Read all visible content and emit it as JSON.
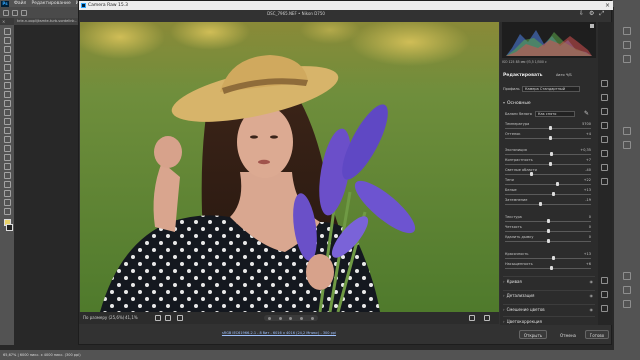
{
  "ps": {
    "logo": "Ps",
    "menu": [
      "Файл",
      "Редактирование",
      "Изображ"
    ],
    "tab": "krie-n-ooplijksmte-turb-vordelink..",
    "status": "65,67% | 6000 пикс. x 4000 пикс. (300 ppi)"
  },
  "cr": {
    "title": "Camera Raw 15.3",
    "filename": "DSC_7965.NEF  •  Nikon D750",
    "zoom_label": "По размеру (25,6%)",
    "zoom_value": "41,1%",
    "workflow": "sRGB IEC61966-2.1 - 8 бит - 6016 x 4016 (24,2 Мпикс) - 300 ppi",
    "histogram_info": "ISO 125   85 мм   f/3,5   1/500 с",
    "edit_title": "Редактировать",
    "auto": "Авто   Ч/Б",
    "profile_label": "Профиль",
    "profile_value": "Камера Стандартный",
    "basic": "Основные",
    "wb_label": "Баланс белого",
    "wb_value": "Как снято",
    "sliders": [
      {
        "label": "Температура",
        "value": "5700",
        "pos": 0.52
      },
      {
        "label": "Оттенок",
        "value": "+4",
        "pos": 0.52
      },
      {
        "label": "Экспозиция",
        "value": "+0,35",
        "pos": 0.54
      },
      {
        "label": "Контрастность",
        "value": "+7",
        "pos": 0.52
      },
      {
        "label": "Светлые области",
        "value": "-40",
        "pos": 0.3
      },
      {
        "label": "Тени",
        "value": "+22",
        "pos": 0.61
      },
      {
        "label": "Белые",
        "value": "+13",
        "pos": 0.56
      },
      {
        "label": "Затемнение",
        "value": "-19",
        "pos": 0.4
      },
      {
        "label": "Текстура",
        "value": "0",
        "pos": 0.5
      },
      {
        "label": "Четкость",
        "value": "0",
        "pos": 0.5
      },
      {
        "label": "Удалить дымку",
        "value": "0",
        "pos": 0.5
      },
      {
        "label": "Красочность",
        "value": "+13",
        "pos": 0.56
      },
      {
        "label": "Насыщенность",
        "value": "+6",
        "pos": 0.53
      }
    ],
    "sections": [
      "Кривая",
      "Детализация",
      "Смешение цветов",
      "Цветокоррекция"
    ],
    "buttons": {
      "open": "Открыть",
      "cancel": "Отмена",
      "done": "Готово"
    },
    "colors": {
      "accent": "#e8e8e8",
      "panel": "#2c2c2c",
      "dialog": "#323232"
    }
  }
}
